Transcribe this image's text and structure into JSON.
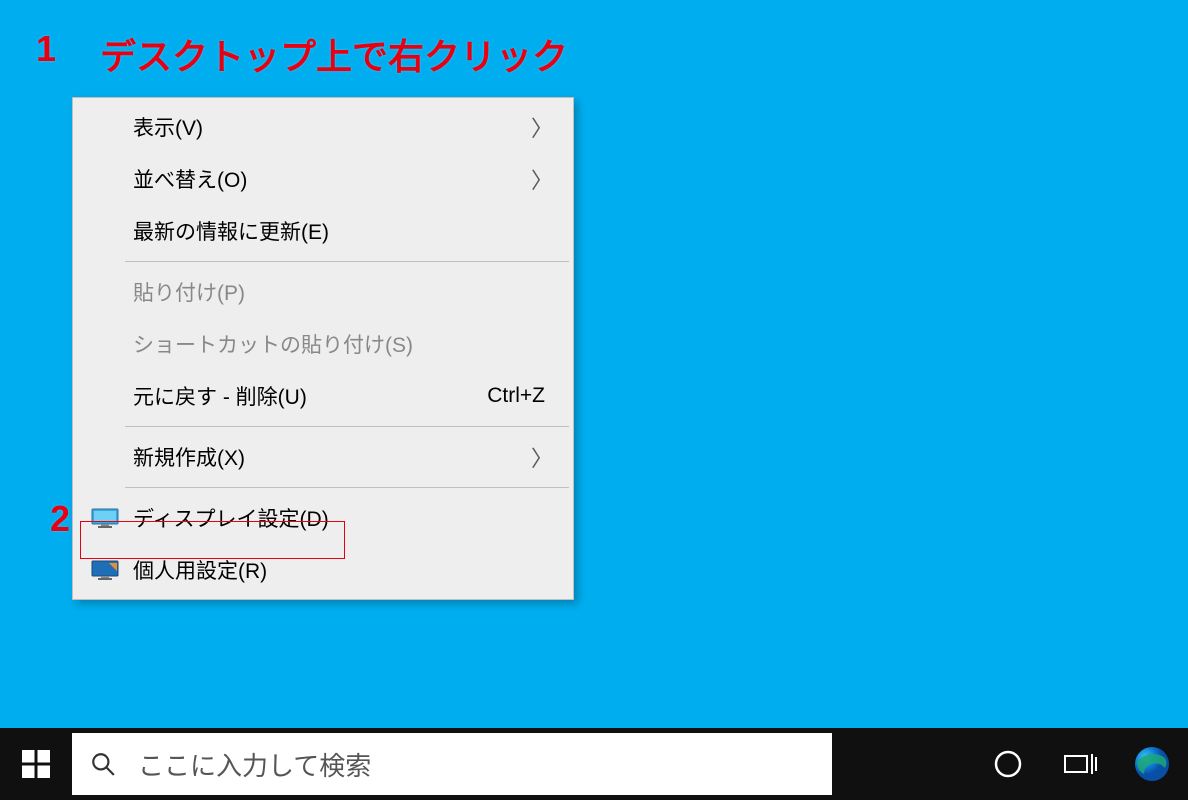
{
  "annotations": {
    "step1_num": "1",
    "step1_text": "デスクトップ上で右クリック",
    "step2_num": "2"
  },
  "context_menu": {
    "items": [
      {
        "label": "表示(V)",
        "has_submenu": true
      },
      {
        "label": "並べ替え(O)",
        "has_submenu": true
      },
      {
        "label": "最新の情報に更新(E)"
      },
      {
        "separator": true
      },
      {
        "label": "貼り付け(P)",
        "disabled": true
      },
      {
        "label": "ショートカットの貼り付け(S)",
        "disabled": true
      },
      {
        "label": "元に戻す - 削除(U)",
        "shortcut": "Ctrl+Z"
      },
      {
        "separator": true
      },
      {
        "label": "新規作成(X)",
        "has_submenu": true
      },
      {
        "separator": true
      },
      {
        "label": "ディスプレイ設定(D)",
        "icon": "display"
      },
      {
        "label": "個人用設定(R)",
        "icon": "personalize"
      }
    ]
  },
  "taskbar": {
    "search_placeholder": "ここに入力して検索"
  }
}
